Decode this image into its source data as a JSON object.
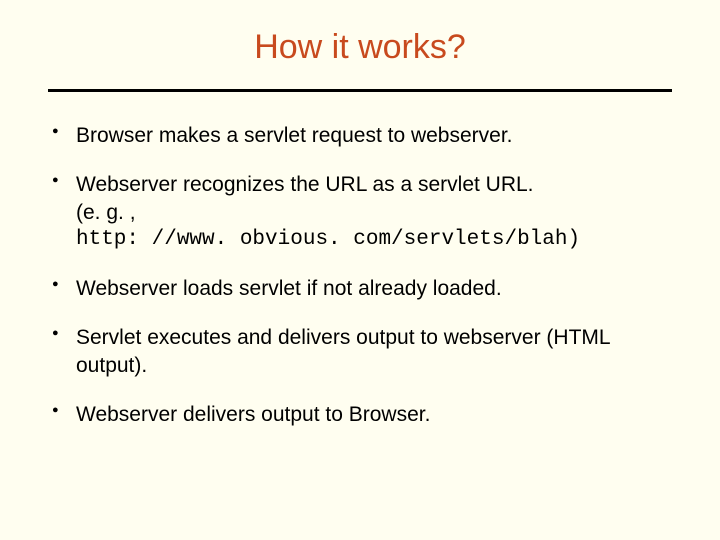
{
  "title": "How it works?",
  "bullets": [
    {
      "text": "Browser makes a servlet request to webserver."
    },
    {
      "text": "Webserver recognizes the URL as a servlet URL.",
      "sub_plain": "(e. g. ,",
      "sub_mono": "http: //www. obvious. com/servlets/blah)"
    },
    {
      "text": "Webserver loads servlet if not already loaded."
    },
    {
      "text": "Servlet executes and delivers output to webserver (HTML output)."
    },
    {
      "text": "Webserver delivers output to Browser."
    }
  ]
}
